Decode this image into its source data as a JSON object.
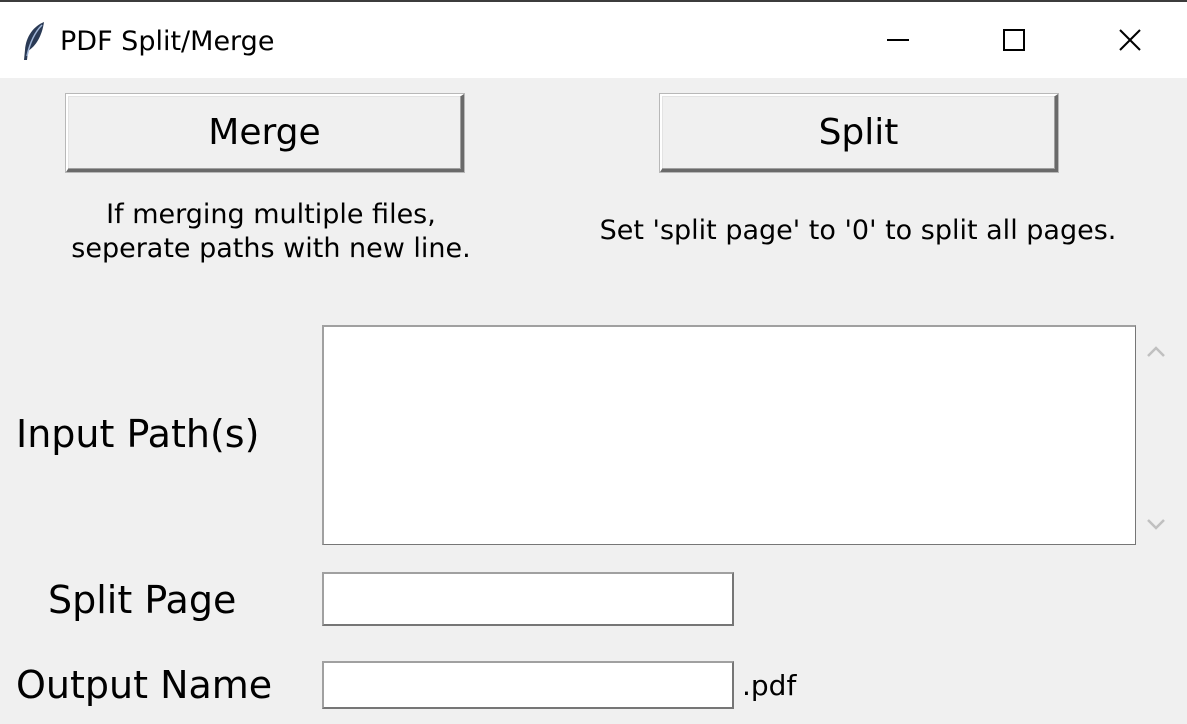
{
  "window": {
    "title": "PDF Split/Merge",
    "icon": "feather-icon"
  },
  "buttons": {
    "merge_label": "Merge",
    "split_label": "Split"
  },
  "hints": {
    "merge": "If merging multiple files,\nseperate paths with new line.",
    "split": "Set 'split page' to '0' to split all pages."
  },
  "form": {
    "input_paths_label": "Input Path(s)",
    "input_paths_value": "",
    "split_page_label": "Split Page",
    "split_page_value": "",
    "output_name_label": "Output Name",
    "output_name_value": "",
    "output_suffix": ".pdf"
  }
}
